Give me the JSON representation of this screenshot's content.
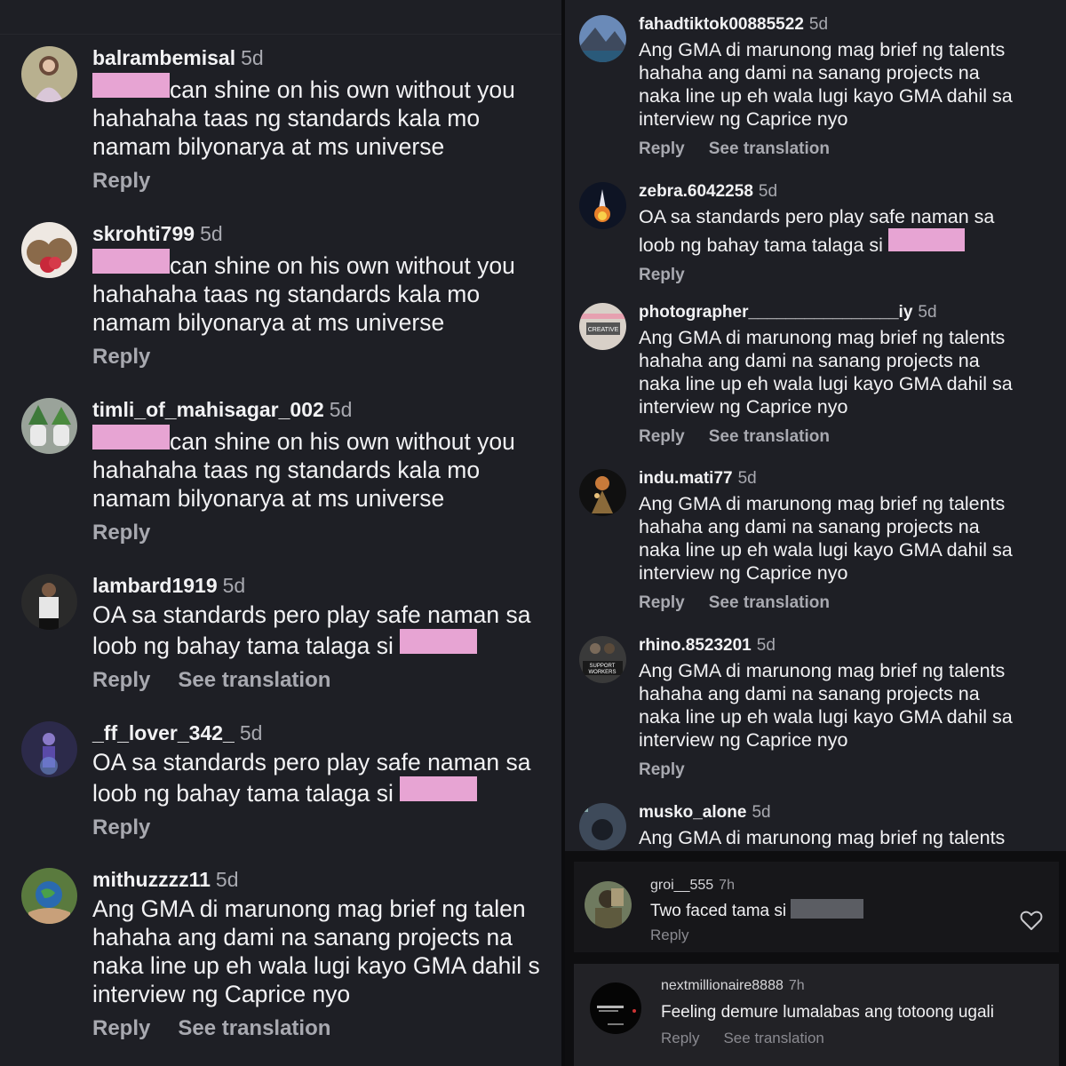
{
  "left_comments": [
    {
      "user": "balrambemisal",
      "time": "5d",
      "lines": [
        "can shine on his own without you",
        "hahahaha taas ng standards kala mo",
        "namam bilyonarya at ms universe"
      ],
      "redact_start": true,
      "actions": [
        "Reply"
      ]
    },
    {
      "user": "skrohti799",
      "time": "5d",
      "lines": [
        "can shine on his own without you",
        "hahahaha taas ng standards kala mo",
        "namam bilyonarya at ms universe"
      ],
      "redact_start": true,
      "actions": [
        "Reply"
      ]
    },
    {
      "user": "timli_of_mahisagar_002",
      "time": "5d",
      "lines": [
        "can shine on his own without you",
        "hahahaha taas ng standards kala mo",
        "namam bilyonarya at ms universe"
      ],
      "redact_start": true,
      "actions": [
        "Reply"
      ]
    },
    {
      "user": "lambard1919",
      "time": "5d",
      "lines": [
        "OA sa standards pero play safe naman sa",
        "loob ng bahay tama talaga si "
      ],
      "redact_end": true,
      "actions": [
        "Reply",
        "See translation"
      ]
    },
    {
      "user": "_ff_lover_342_",
      "time": "5d",
      "lines": [
        "OA sa standards pero play safe naman sa",
        "loob ng bahay tama talaga si "
      ],
      "redact_end": true,
      "actions": [
        "Reply"
      ]
    },
    {
      "user": "mithuzzzz11",
      "time": "5d",
      "lines": [
        "Ang GMA di marunong mag brief ng talen",
        "hahaha ang dami na sanang projects na",
        "naka line up eh wala lugi kayo GMA dahil s",
        "interview ng Caprice nyo"
      ],
      "actions": [
        "Reply",
        "See translation"
      ]
    }
  ],
  "right_comments": [
    {
      "user": "fahadtiktok00885522",
      "time": "5d",
      "lines": [
        "Ang GMA di marunong mag brief ng talents",
        "hahaha ang dami na sanang projects na",
        "naka line up eh wala lugi kayo GMA dahil sa",
        "interview ng Caprice nyo"
      ],
      "actions": [
        "Reply",
        "See translation"
      ]
    },
    {
      "user": "zebra.6042258",
      "time": "5d",
      "lines": [
        "OA sa standards pero play safe naman sa",
        "loob ng bahay tama talaga si "
      ],
      "redact_end": true,
      "actions": [
        "Reply"
      ]
    },
    {
      "user": "photographer________________iy",
      "time": "5d",
      "lines": [
        "Ang GMA di marunong mag brief ng talents",
        "hahaha ang dami na sanang projects na",
        "naka line up eh wala lugi kayo GMA dahil sa",
        "interview ng Caprice nyo"
      ],
      "actions": [
        "Reply",
        "See translation"
      ]
    },
    {
      "user": "indu.mati77",
      "time": "5d",
      "lines": [
        "Ang GMA di marunong mag brief ng talents",
        "hahaha ang dami na sanang projects na",
        "naka line up eh wala lugi kayo GMA dahil sa",
        "interview ng Caprice nyo"
      ],
      "actions": [
        "Reply",
        "See translation"
      ]
    },
    {
      "user": "rhino.8523201",
      "time": "5d",
      "lines": [
        "Ang GMA di marunong mag brief ng talents",
        "hahaha ang dami na sanang projects na",
        "naka line up eh wala lugi kayo GMA dahil sa",
        "interview ng Caprice nyo"
      ],
      "actions": [
        "Reply"
      ]
    },
    {
      "user": "musko_alone",
      "time": "5d",
      "lines": [
        "Ang GMA di marunong mag brief ng talents"
      ],
      "actions": []
    }
  ],
  "bottom_comments": [
    {
      "user": "groi__555",
      "time": "7h",
      "text": "Two faced tama si ",
      "actions": [
        "Reply"
      ],
      "icon": "heart-outline-icon"
    },
    {
      "user": "nextmillionaire8888",
      "time": "7h",
      "text": "Feeling demure lumalabas ang totoong ugali",
      "actions": [
        "Reply",
        "See translation"
      ]
    }
  ],
  "avatar_text": {
    "photographer": "CREATIVE",
    "rhino": "SUPPORT WORKERS"
  },
  "colors": {
    "background": "#1e1f25",
    "redaction_pink": "#e7a4d3",
    "redaction_grey": "#5b5d63",
    "muted_text": "#a8a9b0"
  }
}
